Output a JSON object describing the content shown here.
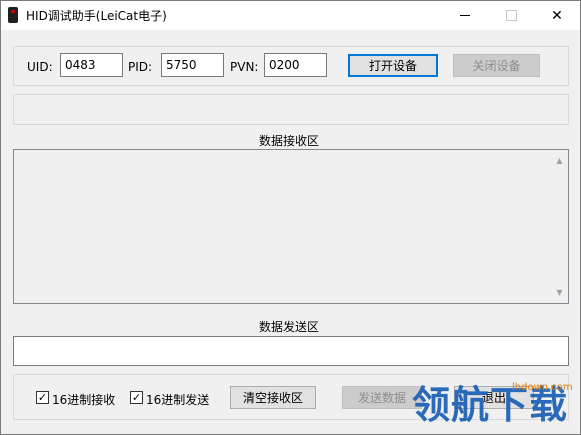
{
  "window": {
    "title": "HID调试助手(LeiCat电子)"
  },
  "device": {
    "uid_label": "UID:",
    "uid_value": "0483",
    "pid_label": "PID:",
    "pid_value": "5750",
    "pvn_label": "PVN:",
    "pvn_value": "0200",
    "open_button": "打开设备",
    "close_button": "关闭设备"
  },
  "receive": {
    "title": "数据接收区"
  },
  "send": {
    "title": "数据发送区",
    "value": ""
  },
  "bottom": {
    "hex_receive_label": "16进制接收",
    "hex_receive_checked": true,
    "hex_send_label": "16进制发送",
    "hex_send_checked": true,
    "clear_button": "清空接收区",
    "send_button": "发送数据",
    "exit_button": "退出"
  },
  "watermark": {
    "text": "领航下载",
    "site": "lhdown.com"
  }
}
